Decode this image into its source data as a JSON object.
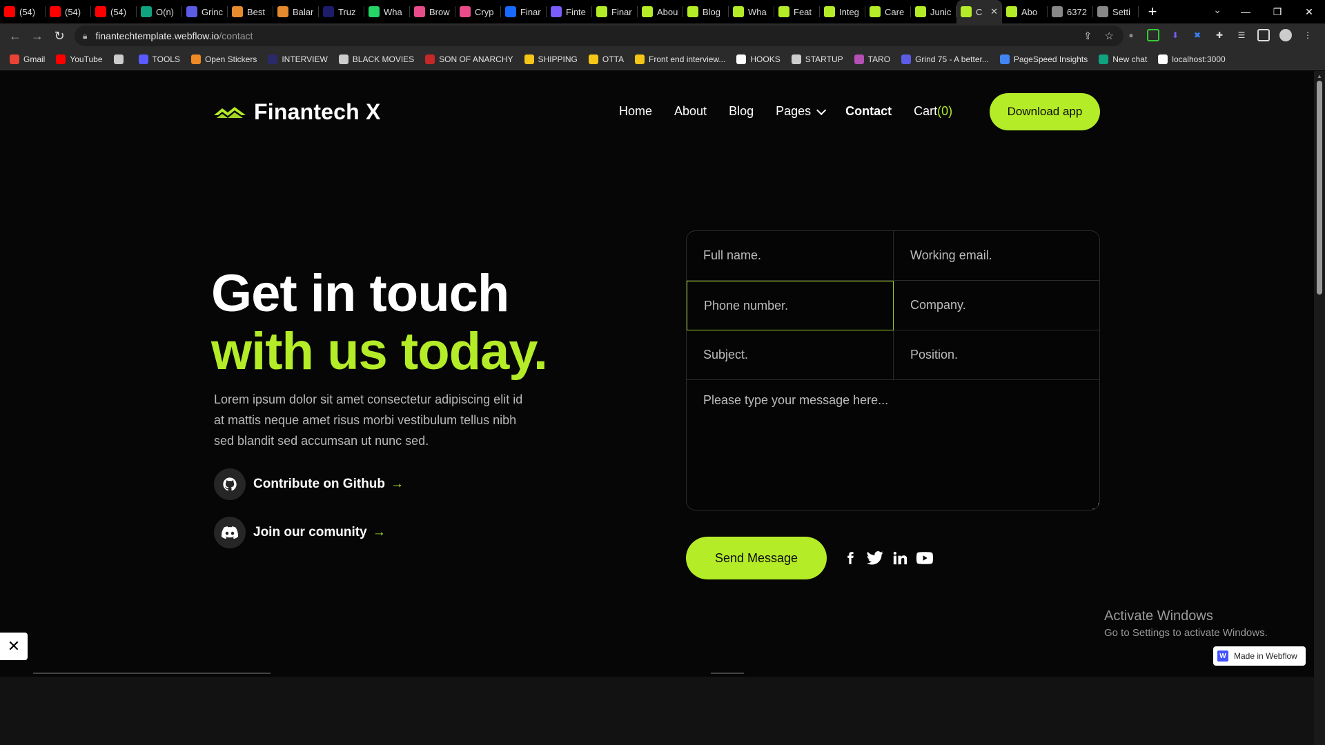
{
  "browser": {
    "tabs": [
      {
        "title": "(54)",
        "icon": "youtube-icon",
        "color": "#ff0000"
      },
      {
        "title": "(54)",
        "icon": "youtube-icon",
        "color": "#ff0000"
      },
      {
        "title": "(54)",
        "icon": "youtube-icon",
        "color": "#ff0000"
      },
      {
        "title": "O(n)",
        "icon": "chatgpt-icon",
        "color": "#10a37f"
      },
      {
        "title": "Grinc",
        "icon": "grind75-icon",
        "color": "#5c5ce6"
      },
      {
        "title": "Best",
        "icon": "codeforces-icon",
        "color": "#e68a2e"
      },
      {
        "title": "Balar",
        "icon": "codeforces-icon",
        "color": "#e68a2e"
      },
      {
        "title": "Truz",
        "icon": "truz-icon",
        "color": "#1c1c6b"
      },
      {
        "title": "Wha",
        "icon": "whatsapp-icon",
        "color": "#25d366"
      },
      {
        "title": "Brow",
        "icon": "dribbble-icon",
        "color": "#ea4c89"
      },
      {
        "title": "Cryp",
        "icon": "dribbble-icon",
        "color": "#ea4c89"
      },
      {
        "title": "Finar",
        "icon": "behance-icon",
        "color": "#1769ff"
      },
      {
        "title": "Finte",
        "icon": "grid-icon",
        "color": "#7a5cff"
      },
      {
        "title": "Finar",
        "icon": "finantech-icon",
        "color": "#b4ec28"
      },
      {
        "title": "Abou",
        "icon": "finantech-icon",
        "color": "#b4ec28"
      },
      {
        "title": "Blog",
        "icon": "finantech-icon",
        "color": "#b4ec28"
      },
      {
        "title": "Wha",
        "icon": "finantech-icon",
        "color": "#b4ec28"
      },
      {
        "title": "Feat",
        "icon": "finantech-icon",
        "color": "#b4ec28"
      },
      {
        "title": "Integ",
        "icon": "finantech-icon",
        "color": "#b4ec28"
      },
      {
        "title": "Care",
        "icon": "finantech-icon",
        "color": "#b4ec28"
      },
      {
        "title": "Junic",
        "icon": "finantech-icon",
        "color": "#b4ec28"
      },
      {
        "title": "C",
        "icon": "finantech-icon",
        "color": "#b4ec28",
        "active": true
      },
      {
        "title": "Abo",
        "icon": "finantech-icon",
        "color": "#b4ec28"
      },
      {
        "title": "6372",
        "icon": "chatgpt-icon",
        "color": "#888888"
      },
      {
        "title": "Setti",
        "icon": "gear-icon",
        "color": "#888888"
      }
    ],
    "url_host": "finantechtemplate.webflow.io",
    "url_path": "/contact",
    "bookmarks": [
      {
        "label": "Gmail",
        "color": "#ea4335"
      },
      {
        "label": "YouTube",
        "color": "#ff0000"
      },
      {
        "label": "",
        "color": "#cccccc"
      },
      {
        "label": "TOOLS",
        "color": "#5a5aff"
      },
      {
        "label": "Open Stickers",
        "color": "#f08a24"
      },
      {
        "label": "INTERVIEW",
        "color": "#2a2a6b"
      },
      {
        "label": "BLACK MOVIES",
        "color": "#cccccc"
      },
      {
        "label": "SON OF ANARCHY",
        "color": "#c62828"
      },
      {
        "label": "SHIPPING",
        "color": "#f5c518"
      },
      {
        "label": "OTTA",
        "color": "#f5c518"
      },
      {
        "label": "Front end interview...",
        "color": "#f5c518"
      },
      {
        "label": "HOOKS",
        "color": "#ffffff"
      },
      {
        "label": "STARTUP",
        "color": "#cccccc"
      },
      {
        "label": "TARO",
        "color": "#b44fb4"
      },
      {
        "label": "Grind 75 - A better...",
        "color": "#5c5ce6"
      },
      {
        "label": "PageSpeed Insights",
        "color": "#4285f4"
      },
      {
        "label": "New chat",
        "color": "#10a37f"
      },
      {
        "label": "localhost:3000",
        "color": "#ffffff"
      }
    ]
  },
  "site": {
    "brand": "Finantech X",
    "nav": {
      "home": "Home",
      "about": "About",
      "blog": "Blog",
      "pages": "Pages",
      "contact": "Contact",
      "cart_label": "Cart",
      "cart_count": "(0)"
    },
    "download_button": "Download app",
    "accent_color": "#b4ec28"
  },
  "hero": {
    "title_line1": "Get in touch",
    "title_line2": "with us today.",
    "body": "Lorem ipsum dolor sit amet consectetur adipiscing elit id at mattis neque amet risus morbi vestibulum tellus nibh sed blandit sed accumsan ut nunc sed.",
    "github_link": "Contribute on Github",
    "community_link": "Join our comunity",
    "arrow": "→"
  },
  "form": {
    "full_name_placeholder": "Full name.",
    "email_placeholder": "Working email.",
    "phone_placeholder": "Phone number.",
    "company_placeholder": "Company.",
    "subject_placeholder": "Subject.",
    "position_placeholder": "Position.",
    "message_placeholder": "Please type your message here...",
    "submit": "Send Message"
  },
  "socials": [
    "facebook-icon",
    "twitter-icon",
    "linkedin-icon",
    "youtube-icon"
  ],
  "overlay": {
    "activate_title": "Activate Windows",
    "activate_sub": "Go to Settings to activate Windows.",
    "webflow_badge": "Made in Webflow"
  }
}
